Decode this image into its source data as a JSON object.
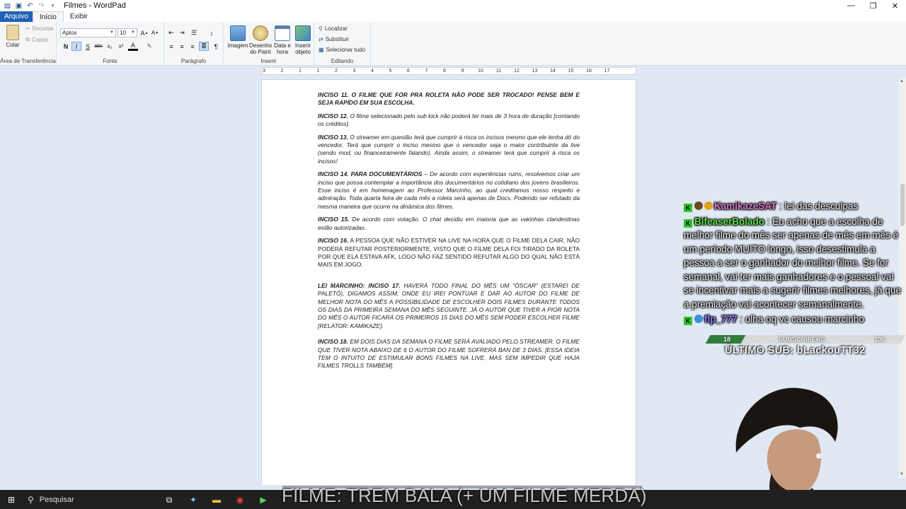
{
  "window": {
    "title": "Filmes - WordPad",
    "controls": [
      "—",
      "❐",
      "✕"
    ]
  },
  "tabs": [
    {
      "label": "Arquivo"
    },
    {
      "label": "Início"
    },
    {
      "label": "Exibir"
    }
  ],
  "ribbon": {
    "clipboard": {
      "paste": "Colar",
      "cut": "Recortar",
      "copy": "Copiar",
      "label": "Área de Transferência"
    },
    "font": {
      "family": "Aptos",
      "size": "10",
      "bold": "N",
      "italic": "I",
      "underline": "S",
      "strike": "abc",
      "subscript": "x₂",
      "superscript": "x²",
      "label": "Fonte"
    },
    "paragraph": {
      "label": "Parágrafo"
    },
    "insert": {
      "image": "Imagem",
      "paint_line1": "Desenho",
      "paint_line2": "do Paint",
      "datetime_line1": "Data e",
      "datetime_line2": "hora",
      "object_line1": "Inserir",
      "object_line2": "objeto",
      "label": "Inserir"
    },
    "editing": {
      "find": "Localizar",
      "replace": "Substituir",
      "select_all": "Selecionar tudo",
      "label": "Editando"
    }
  },
  "ruler": {
    "labels": [
      "3",
      "2",
      "1",
      "1",
      "2",
      "3",
      "4",
      "5",
      "6",
      "7",
      "8",
      "9",
      "10",
      "11",
      "12",
      "13",
      "14",
      "15",
      "16",
      "17"
    ]
  },
  "document": {
    "paragraphs": [
      {
        "head": "INCISO 11. O FILME QUE FOR PRA ROLETA NÃO PODE SER TROCADO! PENSE BEM E SEJA RAPÍDO EM SUA ESCOLHA.",
        "body": ""
      },
      {
        "head": "INCISO 12.",
        "body": " O filme selecionado pelo sub kick não poderá ter mais de 3 hora de duração [contando os créditos]."
      },
      {
        "head": "INCISO 13.",
        "body": " O streamer em questão terá que cumprir à risca os incisos mesmo que ele tenha dó do vencedor. Terá que cumprir o inciso mesmo que o vencedor seja o maior contribuinte da live (sendo mod, ou financeiramente falando). Ainda assim, o streamer terá que cumprir à risca os incisos!"
      },
      {
        "head": "INCISO 14. PARA DOCUMENTÁRIOS",
        "body": " – De acordo com experiências ruins, resolvemos criar um inciso que possa contemplar a importância dos documentários no cotidiano dos jovens brasileiros. Esse inciso é em homenagem ao Professor Marcinho, ao qual creditamos nosso respeito e admiração. Toda quarta feira de cada mês a roleta será apenas de Docs. Podendo ser refutado da mesma maneira que ocorre na dinâmica dos filmes."
      },
      {
        "head": "INCISO 15.",
        "body": " De acordo com votação. O chat decidiu em maioria que as vakinhas clandestinas estão autorizadas."
      },
      {
        "head": "INCISO 16.",
        "body": " A PESSOA QUE NÃO ESTIVER NA LIVE NA HORA QUE O FILME DELA CAIR, NÃO PODERÁ REFUTAR POSTERIORMENTE, VISTO QUE O FILME DELA FOI TIRADO DA ROLETA POR QUE ELA ESTAVA AFK, LOGO NÃO FAZ SENTIDO REFUTAR ALGO DO QUAL NÃO ESTÁ MAIS EM JOGO."
      },
      {
        "head": "LEI MARCINHO: INCISO 17.",
        "body": " HAVERÁ TODO FINAL DO MÊS UM \"ÓSCAR\" (ESTAREI DE PALETÓ), DIGAMOS ASSIM, ONDE EU IREI PONTUAR E DAR AO AUTOR DO FILME DE MELHOR NOTA DO MÊS A POSSIBILIDADE DE ESCOLHER DOIS FILMES DURANTE TODOS OS DIAS DA PRIMEIRA SEMANA DO MÊS SEGUINTE. JÁ O AUTOR QUE TIVER A PIOR NOTA DO MÊS O AUTOR FICARÁ OS PRIMEIROS 15 DIAS DO MÊS SEM PODER ESCOLHER FILME [RELATOR: KAMIKAZE]."
      },
      {
        "head": "INCISO 18.",
        "body": " EM DOIS DIAS DA SEMANA O FILME SERÁ AVALIADO PELO STREAMER. O FILME QUE TIVER NOTA ABAIXO DE 6 O AUTOR DO FILME SOFRERÁ BAN DE 3 DIAS. [ESSA IDEIA TEM O INTUITO DE ESTIMULAR BONS FILMES NA LIVE, MAS SEM IMPEDIR QUE HAJA FILMES TROLLS TAMBÉM]."
      }
    ]
  },
  "chat": {
    "messages": [
      {
        "user": "KamikazeSAT",
        "color": "#d877c9",
        "text": " : lei das desculpas"
      },
      {
        "user": "BifeaserBolado",
        "color": "#5ee04a",
        "text": " : Eu acho que a escolha de melhor filme do mês ser apenas de mês em mês é um período MUITO longo, isso desestimula a pessoa a ser o ganhador do melhor filme. Se for semanal, vai ter mais ganhadores e o pessoal vai se incentivar mais a sugerir filmes melhores, já que a premiação vai acontecer semanalmente."
      },
      {
        "user": "flp_777",
        "color": "#8f7fff",
        "text": " : olha oq vc causou marcinho"
      }
    ]
  },
  "subgoal": {
    "current": "18",
    "label": "SUBSCRIBERS",
    "target": "100",
    "progress": 0.18,
    "last_sub": "ÚLTIMO SUB: bLackouTT32"
  },
  "banner": {
    "text": "FILME: TREM BALA (+ UM FILME MERDA)"
  },
  "taskbar": {
    "search": "Pesquisar"
  },
  "colors": {
    "accent": "#1f62b4",
    "chat_text": "#f4f4f4",
    "badge": "#2ec52e",
    "subbar_fill": "#2f7d3a"
  }
}
